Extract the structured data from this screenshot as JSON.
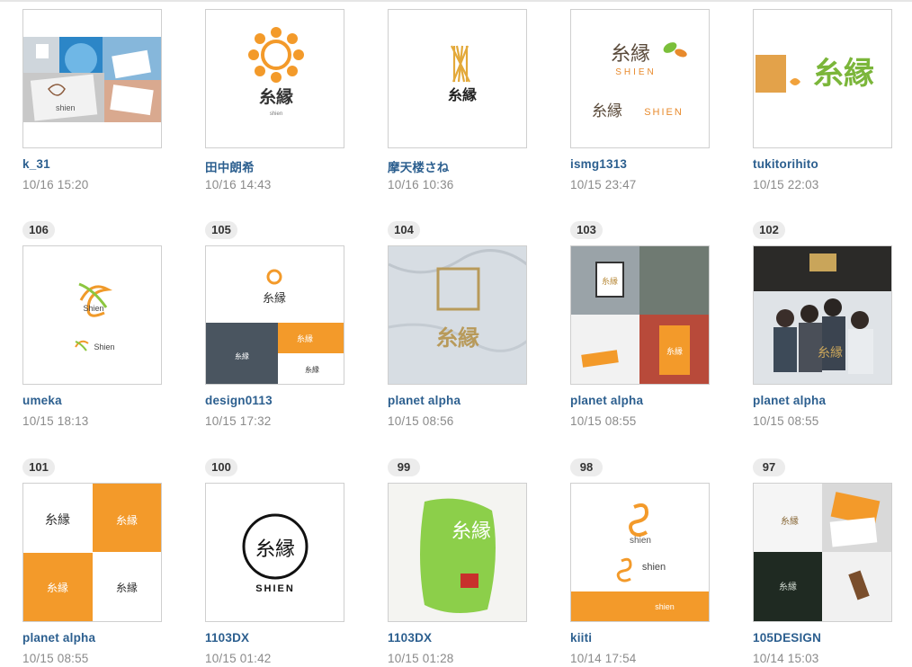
{
  "rows": [
    {
      "entries": [
        {
          "number": "",
          "author": "k_31",
          "time": "10/16 15:20",
          "thumbnail": "collage-mockup"
        },
        {
          "number": "",
          "author": "田中朗希",
          "time": "10/16 14:43",
          "thumbnail": "orange-flower-logo",
          "logo_text": "糸縁",
          "logo_sub": "shien"
        },
        {
          "number": "",
          "author": "摩天楼さね",
          "time": "10/16 10:36",
          "thumbnail": "gold-threads-logo",
          "logo_text": "糸縁"
        },
        {
          "number": "",
          "author": "ismg1313",
          "time": "10/15 23:47",
          "thumbnail": "green-script-logo",
          "logo_text": "糸縁",
          "logo_sub": "SHIEN"
        },
        {
          "number": "",
          "author": "tukitorihito",
          "time": "10/15 22:03",
          "thumbnail": "stamp-green-logo",
          "logo_text": "糸縁"
        }
      ]
    },
    {
      "entries": [
        {
          "number": "106",
          "author": "umeka",
          "time": "10/15 18:13",
          "thumbnail": "shien-swirl-logo",
          "logo_text": "Shien"
        },
        {
          "number": "105",
          "author": "design0113",
          "time": "10/15 17:32",
          "thumbnail": "orange-g-collage",
          "logo_text": "糸縁"
        },
        {
          "number": "104",
          "author": "planet alpha",
          "time": "10/15 08:56",
          "thumbnail": "marble-gold-logo",
          "logo_text": "糸縁"
        },
        {
          "number": "103",
          "author": "planet alpha",
          "time": "10/15 08:55",
          "thumbnail": "signage-collage",
          "logo_text": "糸縁"
        },
        {
          "number": "102",
          "author": "planet alpha",
          "time": "10/15 08:55",
          "thumbnail": "office-team-photo",
          "logo_text": "糸縁"
        }
      ]
    },
    {
      "entries": [
        {
          "number": "101",
          "author": "planet alpha",
          "time": "10/15 08:55",
          "thumbnail": "orange-checker-logo",
          "logo_text": "糸縁"
        },
        {
          "number": "100",
          "author": "1103DX",
          "time": "10/15 01:42",
          "thumbnail": "circle-brush-logo",
          "logo_text": "糸縁",
          "logo_sub": "SHIEN"
        },
        {
          "number": "99",
          "author": "1103DX",
          "time": "10/15 01:28",
          "thumbnail": "green-brush-logo",
          "logo_text": "糸縁"
        },
        {
          "number": "98",
          "author": "kiiti",
          "time": "10/14 17:54",
          "thumbnail": "orange-s-logo",
          "logo_text": "shien"
        },
        {
          "number": "97",
          "author": "105DESIGN",
          "time": "10/14 15:03",
          "thumbnail": "stationery-collage",
          "logo_text": "糸縁"
        }
      ]
    }
  ],
  "colors": {
    "author": "#2c5f8f",
    "time": "#8a8a8a",
    "badge_bg": "#ececec",
    "orange": "#f39a2a",
    "green": "#7bbf3a"
  }
}
